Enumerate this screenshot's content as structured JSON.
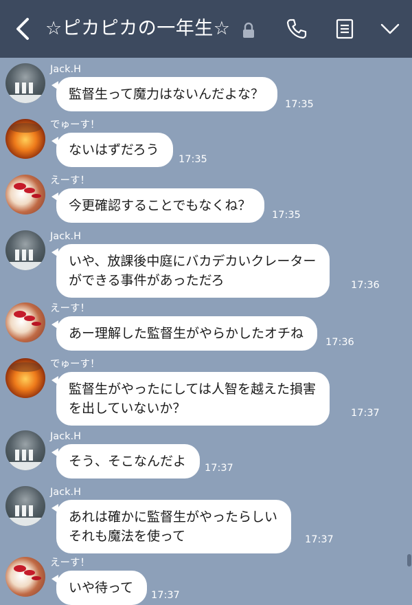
{
  "header": {
    "title": "☆ピカピカの一年生☆",
    "back_icon": "back-chevron-icon",
    "lock_icon": "lock-icon",
    "call_icon": "phone-icon",
    "notes_icon": "notes-icon",
    "more_icon": "chevron-down-icon"
  },
  "colors": {
    "header_bg": "#3d4a5f",
    "chat_bg": "#8da0b9",
    "bubble": "#ffffff"
  },
  "messages": [
    {
      "sender": "Jack.H",
      "lines": [
        "監督生って魔力はないんだよな？"
      ],
      "time": "17:35"
    },
    {
      "sender": "でゅーす！",
      "lines": [
        "ないはずだろう"
      ],
      "time": "17:35"
    },
    {
      "sender": "えーす！",
      "lines": [
        "今更確認することでもなくね？"
      ],
      "time": "17:35"
    },
    {
      "sender": "Jack.H",
      "lines": [
        "いや、放課後中庭にバカデカいクレーター",
        "ができる事件があっただろ"
      ],
      "time": "17:36"
    },
    {
      "sender": "えーす！",
      "lines": [
        "あー理解した監督生がやらかしたオチね"
      ],
      "time": "17:36"
    },
    {
      "sender": "でゅーす！",
      "lines": [
        "監督生がやったにしては人智を越えた損害",
        "を出していないか？"
      ],
      "time": "17:37"
    },
    {
      "sender": "Jack.H",
      "lines": [
        "そう、そこなんだよ"
      ],
      "time": "17:37"
    },
    {
      "sender": "Jack.H",
      "lines": [
        "あれは確かに監督生がやったらしい",
        "それも魔法を使って"
      ],
      "time": "17:37"
    },
    {
      "sender": "えーす！",
      "lines": [
        "いや待って"
      ],
      "time": "17:37"
    }
  ]
}
